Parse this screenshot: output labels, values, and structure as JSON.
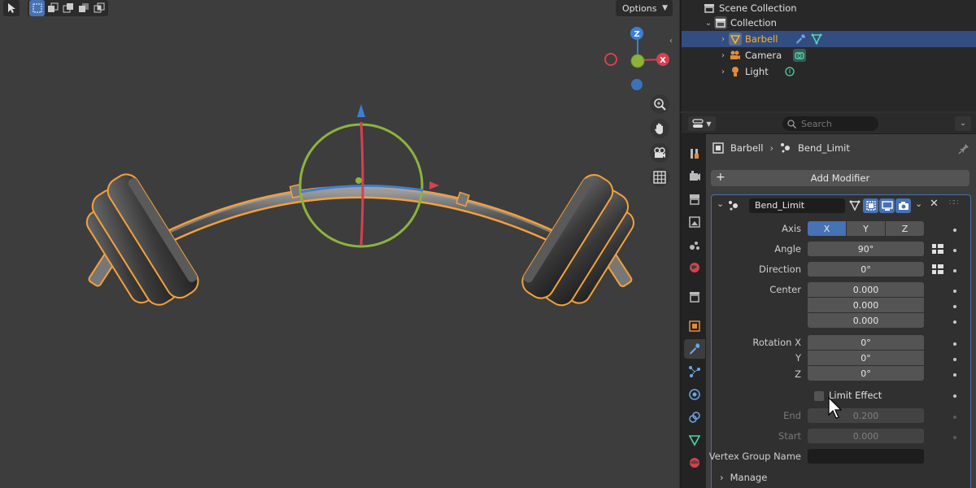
{
  "viewport": {
    "options_label": "Options"
  },
  "outliner": {
    "scene_collection": "Scene Collection",
    "collection": "Collection",
    "items": [
      {
        "label": "Barbell",
        "selected": true,
        "icon": "mesh-object-icon"
      },
      {
        "label": "Camera",
        "selected": false,
        "icon": "camera-object-icon"
      },
      {
        "label": "Light",
        "selected": false,
        "icon": "light-object-icon"
      }
    ]
  },
  "properties": {
    "search_placeholder": "Search",
    "breadcrumb": {
      "object": "Barbell",
      "modifier": "Bend_Limit"
    },
    "add_modifier_label": "Add Modifier",
    "modifier": {
      "name": "Bend_Limit",
      "axis_label": "Axis",
      "axes": [
        "X",
        "Y",
        "Z"
      ],
      "active_axis": "X",
      "angle_label": "Angle",
      "angle_value": "90°",
      "direction_label": "Direction",
      "direction_value": "0°",
      "center_label": "Center",
      "center_values": [
        "0.000",
        "0.000",
        "0.000"
      ],
      "rotation_label": "Rotation X",
      "rotation_y_label": "Y",
      "rotation_z_label": "Z",
      "rotation_values": [
        "0°",
        "0°",
        "0°"
      ],
      "limit_effect_label": "Limit Effect",
      "limit_effect_checked": false,
      "end_label": "End",
      "end_value": "0.200",
      "start_label": "Start",
      "start_value": "0.000",
      "vertex_group_label": "Vertex Group Name",
      "vertex_group_value": "",
      "manage_label": "Manage"
    }
  },
  "colors": {
    "selection_orange": "#f5a13a",
    "active_blue": "#4772b3",
    "gizmo_x": "#d8404f",
    "gizmo_y": "#8cb43c",
    "gizmo_z": "#3b7fd8"
  }
}
